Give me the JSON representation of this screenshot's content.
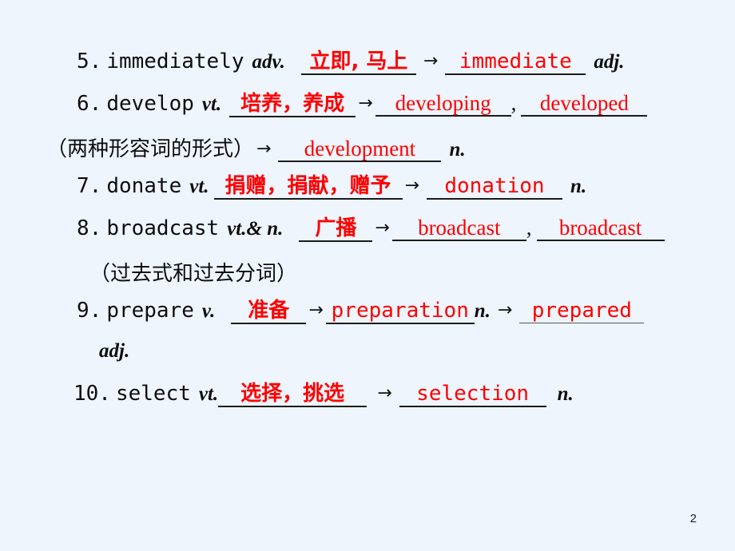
{
  "slide": {
    "page_number": "2",
    "background_color": "#eef5fd",
    "answer_color": "#ff0000",
    "text_color": "#0d0d0d"
  },
  "entries": [
    {
      "index": "5.",
      "word": "immediately",
      "pos": "adv.",
      "meaning": "立即, 马上",
      "arrow": "→",
      "derivative": "immediate",
      "derivative_pos": "adj."
    },
    {
      "index": "6.",
      "word": "develop",
      "pos": "vt.",
      "meaning": "培养，养成",
      "arrow": "→",
      "derivative": "developing",
      "separator": ",",
      "derivative2": "developed",
      "note": "（两种形容词的形式）",
      "arrow2": "→",
      "derivative3": "development",
      "derivative3_pos": "n."
    },
    {
      "index": "7.",
      "word": "donate",
      "pos": "vt.",
      "meaning": "捐赠，捐献，赠予",
      "arrow": "→",
      "derivative": "donation",
      "derivative_pos": "n."
    },
    {
      "index": "8.",
      "word": "broadcast",
      "pos": "vt.& n.",
      "meaning": "广播",
      "arrow": "→",
      "derivative": "broadcast",
      "separator": ",",
      "derivative2": "broadcast",
      "note": "（过去式和过去分词）"
    },
    {
      "index": "9.",
      "word": "prepare",
      "pos": "v.",
      "meaning": "准备",
      "arrow": "→",
      "derivative": "preparation",
      "derivative_pos": "n.",
      "arrow2": "→",
      "derivative2": "prepared",
      "derivative2_pos": "adj."
    },
    {
      "index": "10.",
      "word": "select",
      "pos": "vt.",
      "meaning": "选择，挑选",
      "arrow": "→",
      "derivative": "selection",
      "derivative_pos": "n."
    }
  ]
}
